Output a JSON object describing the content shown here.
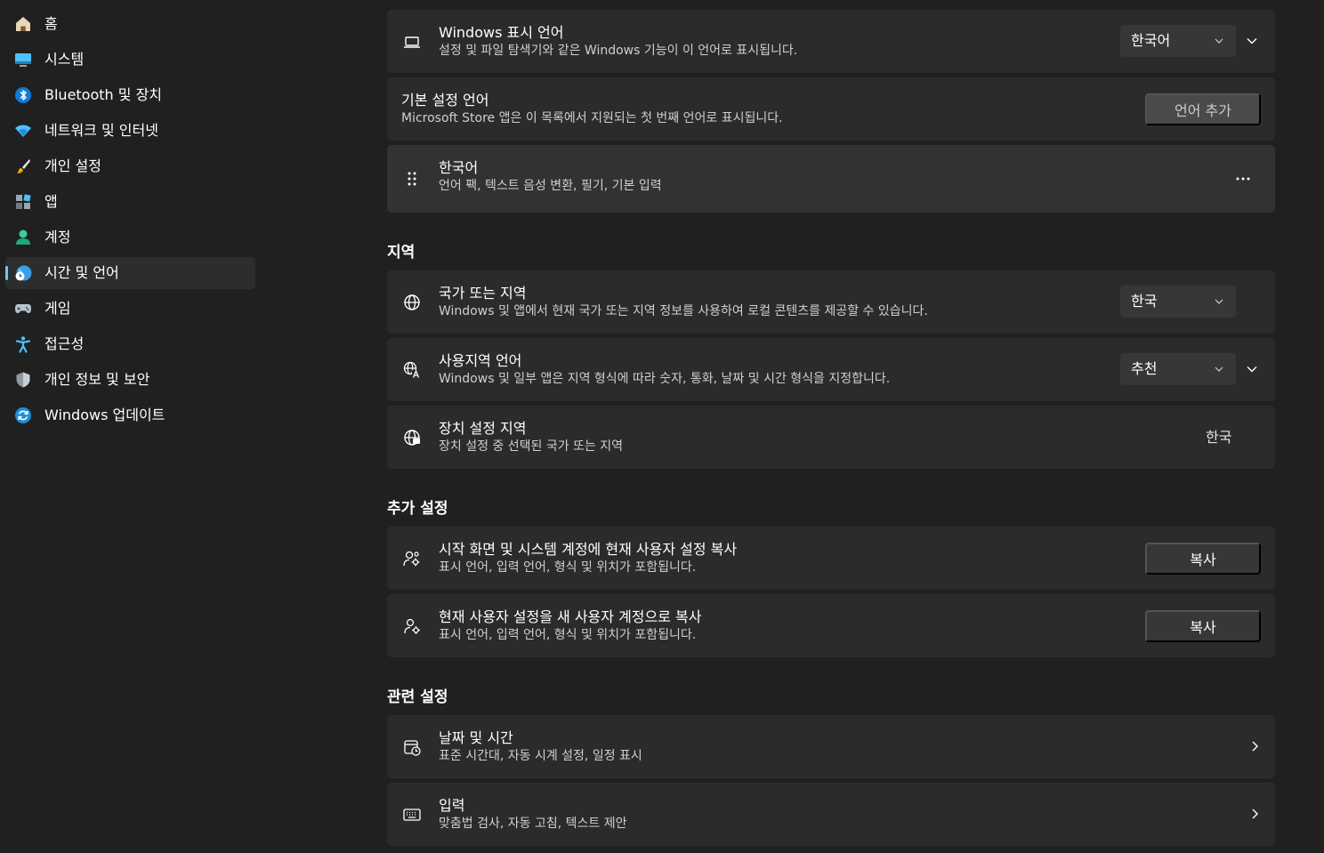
{
  "sidebar": {
    "items": [
      {
        "label": "홈"
      },
      {
        "label": "시스템"
      },
      {
        "label": "Bluetooth 및 장치"
      },
      {
        "label": "네트워크 및 인터넷"
      },
      {
        "label": "개인 설정"
      },
      {
        "label": "앱"
      },
      {
        "label": "계정"
      },
      {
        "label": "시간 및 언어"
      },
      {
        "label": "게임"
      },
      {
        "label": "접근성"
      },
      {
        "label": "개인 정보 및 보안"
      },
      {
        "label": "Windows 업데이트"
      }
    ],
    "active_item": "시간 및 언어"
  },
  "language": {
    "display": {
      "title": "Windows 표시 언어",
      "subtitle": "설정 및 파일 탐색기와 같은 Windows 기능이 이 언어로 표시됩니다.",
      "value": "한국어"
    },
    "preferred": {
      "title": "기본 설정 언어",
      "subtitle": "Microsoft Store 앱은 이 목록에서 지원되는 첫 번째 언어로 표시됩니다.",
      "button": "언어 추가"
    },
    "korean": {
      "title": "한국어",
      "subtitle": "언어 팩, 텍스트 음성 변환, 필기, 기본 입력"
    }
  },
  "region": {
    "heading": "지역",
    "country": {
      "title": "국가 또는 지역",
      "subtitle": "Windows 및 앱에서 현재 국가 또는 지역 정보를 사용하여 로컬 콘텐츠를 제공할 수 있습니다.",
      "value": "한국"
    },
    "format": {
      "title": "사용지역 언어",
      "subtitle": "Windows 및 일부 앱은 지역 형식에 따라 숫자, 통화, 날짜 및 시간 형식을 지정합니다.",
      "value": "추천"
    },
    "device": {
      "title": "장치 설정 지역",
      "subtitle": "장치 설정 중 선택된 국가 또는 지역",
      "value": "한국"
    }
  },
  "additional": {
    "heading": "추가 설정",
    "copy_welcome": {
      "title": "시작 화면 및 시스템 계정에 현재 사용자 설정 복사",
      "subtitle": "표시 언어, 입력 언어, 형식 및 위치가 포함됩니다.",
      "button": "복사"
    },
    "copy_new": {
      "title": "현재 사용자 설정을 새 사용자 계정으로 복사",
      "subtitle": "표시 언어, 입력 언어, 형식 및 위치가 포함됩니다.",
      "button": "복사"
    }
  },
  "related": {
    "heading": "관련 설정",
    "datetime": {
      "title": "날짜 및 시간",
      "subtitle": "표준 시간대, 자동 시계 설정, 일정 표시"
    },
    "typing": {
      "title": "입력",
      "subtitle": "맞춤법 검사, 자동 고침, 텍스트 제안"
    }
  },
  "colors": {
    "accent": "#60cdff",
    "background": "#202020",
    "card": "#2b2b2b"
  }
}
